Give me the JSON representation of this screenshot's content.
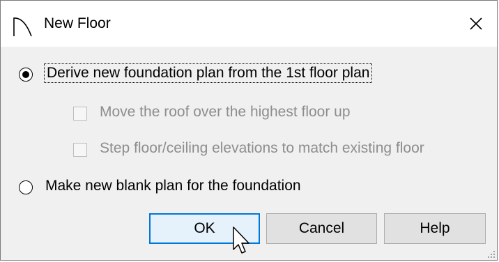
{
  "window": {
    "title": "New Floor",
    "app_icon": "arch-icon",
    "close_icon": "close-icon"
  },
  "options": {
    "derive_label": "Derive new foundation plan from the 1st floor plan",
    "derive_selected": true,
    "move_roof_label": "Move the roof over the highest floor up",
    "step_floor_label": "Step floor/ceiling elevations to match existing floor",
    "blank_label": "Make new blank plan for the foundation",
    "blank_selected": false
  },
  "buttons": {
    "ok": "OK",
    "cancel": "Cancel",
    "help": "Help"
  },
  "colors": {
    "accent": "#0078d7",
    "dialog_bg": "#f0f0f0",
    "disabled_text": "#8d8d8d"
  }
}
